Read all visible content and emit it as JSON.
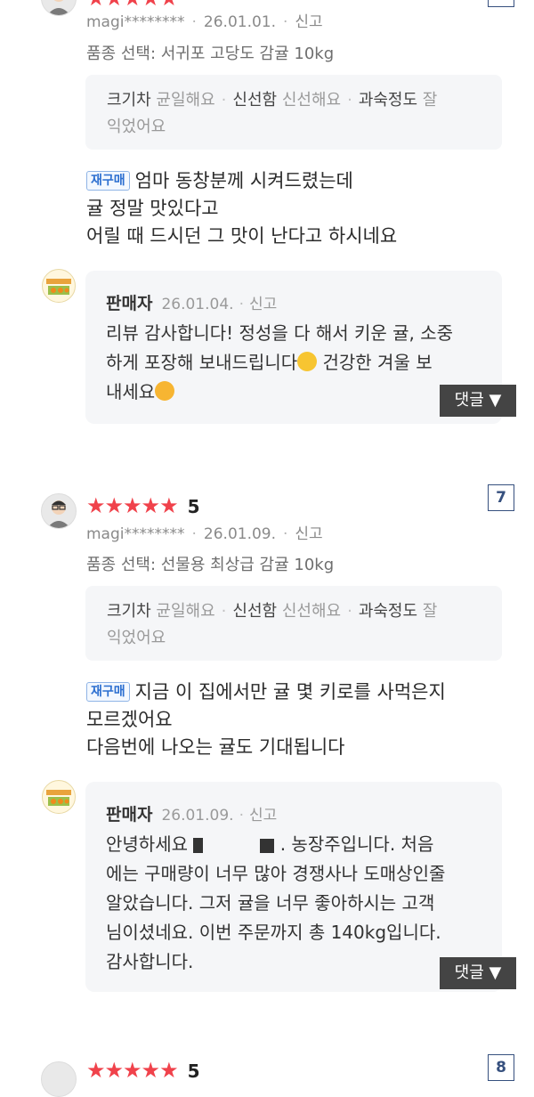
{
  "review1": {
    "user": "magi********",
    "date": "26.01.01.",
    "report": "신고",
    "variant": "품종 선택: 서귀포 고당도 감귤 10kg",
    "attrs": {
      "size_label": "크기차",
      "size_value": "균일해요",
      "fresh_label": "신선함",
      "fresh_value": "신선해요",
      "ripe_label": "과숙정도",
      "ripe_value_1": "잘",
      "ripe_value_2": "익었어요"
    },
    "badge": "재구매",
    "lines": [
      "엄마 동창분께 시켜드렸는데",
      "귤 정말 맛있다고",
      "어릴 때 드시던 그 맛이 난다고 하시네요"
    ],
    "reply": {
      "name": "판매자",
      "date": "26.01.04.",
      "report": "신고",
      "line1": "리뷰 감사합니다! 정성을 다 해서 키운 귤, 소중",
      "line2a": "하게 포장해 보내드립니다",
      "line2b": " 건강한 겨울 보",
      "line3": "내세요",
      "button": "댓글 ▼"
    }
  },
  "review2": {
    "number": "7",
    "score": "5",
    "user": "magi********",
    "date": "26.01.09.",
    "report": "신고",
    "variant": "품종 선택: 선물용 최상급 감귤 10kg",
    "attrs": {
      "size_label": "크기차",
      "size_value": "균일해요",
      "fresh_label": "신선함",
      "fresh_value": "신선해요",
      "ripe_label": "과숙정도",
      "ripe_value_1": "잘",
      "ripe_value_2": "익었어요"
    },
    "badge": "재구매",
    "lines": [
      "지금 이 집에서만 귤 몇 키로를 사먹은지",
      "모르겠어요",
      "다음번에 나오는 귤도 기대됩니다"
    ],
    "reply": {
      "name": "판매자",
      "date": "26.01.09.",
      "report": "신고",
      "line1a": "안녕하세요",
      "line1b": ". 농장주입니다. 처음",
      "line2": "에는 구매량이 너무 많아 경쟁사나 도매상인줄",
      "line3": "알았습니다. 그저 귤을 너무 좋아하시는 고객",
      "line4": "님이셨네요. 이번 주문까지 총 140kg입니다.",
      "line5": "감사합니다.",
      "button": "댓글 ▼"
    }
  },
  "review3": {
    "number": "8",
    "score": "5"
  },
  "stars": "★★★★★",
  "colors": {
    "star": "#f0424b",
    "badge": "#2c6fd0",
    "reply_bg": "#f5f6f8"
  }
}
